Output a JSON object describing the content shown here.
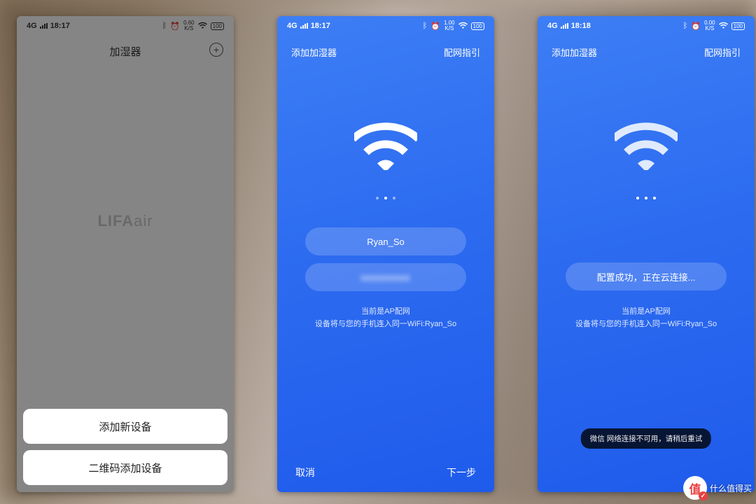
{
  "status": {
    "time1": "18:17",
    "time2": "18:17",
    "time3": "18:18",
    "net_prefix": "4G",
    "speed": "0.60",
    "speed2": "1.00",
    "speed3": "0.00",
    "speed_unit": "K/S",
    "battery": "100"
  },
  "phone1": {
    "title": "加湿器",
    "brand_main": "LIFA",
    "brand_sub": "air",
    "add_button": "+",
    "sheet": {
      "add_new": "添加新设备",
      "add_qr": "二维码添加设备"
    }
  },
  "phone2": {
    "header_left": "添加加湿器",
    "header_right": "配网指引",
    "ssid": "Ryan_So",
    "password_mock": "●●●●●●●●",
    "hint_line1": "当前是AP配网",
    "hint_line2": "设备将与您的手机连入同一WiFi:Ryan_So",
    "footer_cancel": "取消",
    "footer_next": "下一步"
  },
  "phone3": {
    "header_left": "添加加湿器",
    "header_right": "配网指引",
    "status_text": "配置成功，正在云连接...",
    "hint_line1": "当前是AP配网",
    "hint_line2": "设备将与您的手机连入同一WiFi:Ryan_So",
    "toast": "微信  网络连接不可用，请稍后重试"
  },
  "watermark": {
    "badge": "值",
    "text": "什么值得买"
  }
}
